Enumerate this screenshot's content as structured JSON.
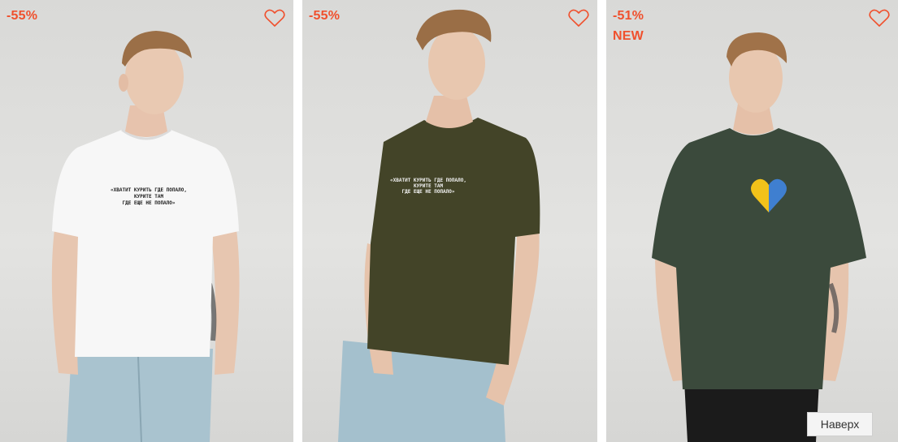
{
  "products": [
    {
      "discount": "-55%",
      "new_label": "",
      "wishlist_icon": "heart-outline-icon",
      "shirt_color": "#f7f7f7",
      "print_lines": [
        "«ХВАТИТ КУРИТЬ ГДЕ ПОПАЛО,",
        "КУРИТЕ ТАМ",
        "ГДЕ ЕЩЕ НЕ ПОПАЛО»"
      ],
      "print_color": "#222222"
    },
    {
      "discount": "-55%",
      "new_label": "",
      "wishlist_icon": "heart-outline-icon",
      "shirt_color": "#434428",
      "print_lines": [
        "«ХВАТИТ КУРИТЬ ГДЕ ПОПАЛО,",
        "КУРИТЕ ТАМ",
        "ГДЕ ЕЩЕ НЕ ПОПАЛО»"
      ],
      "print_color": "#f2f2f2"
    },
    {
      "discount": "-51%",
      "new_label": "NEW",
      "wishlist_icon": "heart-outline-icon",
      "shirt_color": "#3b4a3c",
      "print_lines": [],
      "print_color": "#f2c21a"
    }
  ],
  "colors": {
    "accent": "#f0502d"
  },
  "scroll_top": {
    "label": "Наверх"
  }
}
